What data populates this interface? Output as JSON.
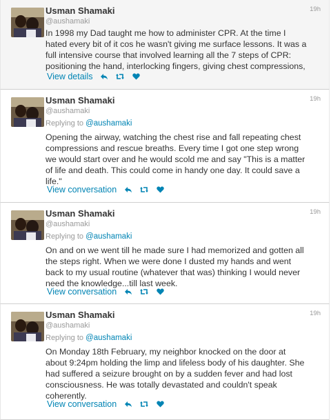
{
  "tweets": [
    {
      "name": "Usman Shamaki",
      "handle": "@aushamaki",
      "time": "19h",
      "reply_prefix": "",
      "reply_to": "",
      "text": "In 1998 my Dad taught me how to administer CPR. At the time I\nhated every bit of it cos he wasn't giving me surface lessons. It was a\nfull intensive course that involved learning all the 7 steps of CPR:\npositioning the hand, interlocking fingers, giving chest compressions,",
      "action_link": "View details"
    },
    {
      "name": "Usman Shamaki",
      "handle": "@aushamaki",
      "time": "19h",
      "reply_prefix": "Replying to ",
      "reply_to": "@aushamaki",
      "text": "Opening the airway, watching the chest rise and fall repeating chest\ncompressions and rescue breaths. Every time I got one step wrong\nwe would start over and he would scold me and say \"This is a matter\nof life and death. This could come in handy one day. It could save a\nlife.\"",
      "action_link": "View conversation"
    },
    {
      "name": "Usman Shamaki",
      "handle": "@aushamaki",
      "time": "19h",
      "reply_prefix": "Replying to ",
      "reply_to": "@aushamaki",
      "text": "On and on we went till he made sure I had memorized and gotten all\nthe steps right. When we were done I dusted my hands and went\nback to my usual routine (whatever that was) thinking I would never\nneed the knowledge...till last week.",
      "action_link": "View conversation"
    },
    {
      "name": "Usman Shamaki",
      "handle": "@aushamaki",
      "time": "19h",
      "reply_prefix": "Replying to ",
      "reply_to": "@aushamaki",
      "text": "On Monday 18th February, my neighbor knocked on the door at\nabout 9:24pm holding the limp and lifeless body of his daughter. She\nhad suffered a seizure brought on by a sudden fever and had lost\nconsciousness. He was totally devastated and couldn't speak\ncoherently.",
      "action_link": "View conversation"
    }
  ],
  "icons": {
    "reply": "reply-icon",
    "retweet": "retweet-icon",
    "like": "heart-icon"
  },
  "colors": {
    "link": "#0084b4",
    "muted": "#999999",
    "text": "#333333"
  }
}
